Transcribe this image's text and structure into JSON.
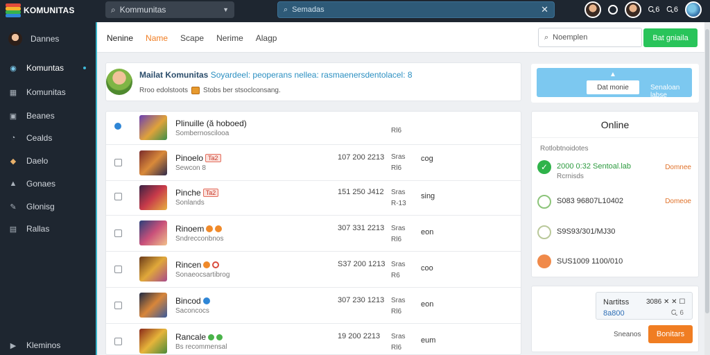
{
  "app": {
    "logo_text": "KOMUNITAS",
    "logo_colors": [
      "#e24b3b",
      "#f5b32e",
      "#37b24d",
      "#2f86d6"
    ]
  },
  "topbar": {
    "search1": "Kommunitas",
    "search2": "Semadas",
    "right_a": "ⓒ",
    "right_b": "Ꮹ6",
    "right_c": "Ꮹ6"
  },
  "sidebar": {
    "items": [
      {
        "label": "Dannes",
        "icon": "user-avatar"
      },
      {
        "label": "Komuntas",
        "icon": "globe-icon",
        "active": true
      },
      {
        "label": "Komunitas",
        "icon": "grid-icon"
      },
      {
        "label": "Beanes",
        "icon": "box-icon"
      },
      {
        "label": "Cealds",
        "icon": "chat-icon"
      },
      {
        "label": "Daelo",
        "icon": "tag-icon"
      },
      {
        "label": "Gonaes",
        "icon": "chart-icon"
      },
      {
        "label": "Glonisg",
        "icon": "wrench-icon"
      },
      {
        "label": "Rallas",
        "icon": "doc-icon"
      },
      {
        "label": "Kleminos",
        "icon": "play-icon"
      }
    ]
  },
  "header": {
    "tabs": [
      "Nenine",
      "Name",
      "Scape",
      "Nerime",
      "Alagp"
    ],
    "search_placeholder": "Noemplen",
    "button": "Bat gniaila"
  },
  "notice": {
    "title_bold": "Mailat Komunitas",
    "title_rest": "Soyardeel: peoperans nellea: rasmaenersdentolacel: 8",
    "sub_a": "Rroo edolstoots",
    "sub_b": "Stobs ber stsoclconsang."
  },
  "rows": [
    {
      "name": "Plinuille (ă hoboed)",
      "sub": "Sombernoscilooa",
      "nums": "",
      "c3a": "Rl6",
      "c3b": "",
      "c4": "",
      "badge": "",
      "marker": "",
      "checked": true
    },
    {
      "name": "Pinoelo",
      "sub": "Sewcon 8",
      "nums": "107 200 2213",
      "c3a": "Sras",
      "c3b": "Rl6",
      "c4": "cog",
      "badge": "Ta2",
      "marker": ""
    },
    {
      "name": "Pinche",
      "sub": "Sonlands",
      "nums": "151 250 J412",
      "c3a": "Sras",
      "c3b": "R-13",
      "c4": "sing",
      "badge": "Ta2",
      "marker": ""
    },
    {
      "name": "Rinoem",
      "sub": "Sndrecconbnos",
      "nums": "307 331 2213",
      "c3a": "Sras",
      "c3b": "Rl6",
      "c4": "eon",
      "badge": "",
      "marker": "orange"
    },
    {
      "name": "Rincen",
      "sub": "Sonaeocsartibrog",
      "nums": "S37 200 1213",
      "c3a": "Sras",
      "c3b": "R6",
      "c4": "coo",
      "badge": "",
      "marker": "redring"
    },
    {
      "name": "Bincod",
      "sub": "Saconcocs",
      "nums": "307 230 1213",
      "c3a": "Sras",
      "c3b": "Rl6",
      "c4": "eon",
      "badge": "",
      "marker": "blue"
    },
    {
      "name": "Rancale",
      "sub": "Bs recommensal",
      "nums": "19 200 2213",
      "c3a": "Sras",
      "c3b": "Rl6",
      "c4": "eum",
      "badge": "",
      "marker": "green"
    }
  ],
  "promo": {
    "button": "Dat monie",
    "link": "Senaloan labse"
  },
  "online": {
    "title": "Online",
    "subtitle": "Rotlobtnoidotes",
    "items": [
      {
        "text": "2000 0:32 Sentoal.lab",
        "sub": "Rcrnisds",
        "action": "Domnee",
        "icon": "green-check"
      },
      {
        "text": "S083 96807L10402",
        "sub": "",
        "action": "Domeoe",
        "icon": "green-ring"
      },
      {
        "text": "S9S93/301/MJ30",
        "sub": "",
        "action": "",
        "icon": "gray-ring"
      },
      {
        "text": "SUS1009 1100/010",
        "sub": "",
        "action": "",
        "icon": "orange-dot"
      }
    ]
  },
  "summary": {
    "a": "Nartitss",
    "b": "8a800",
    "c": "3086 ✕ ✕ ☐",
    "d": "Ꮹ 6",
    "label": "Sneanos",
    "button": "Bonitars"
  }
}
